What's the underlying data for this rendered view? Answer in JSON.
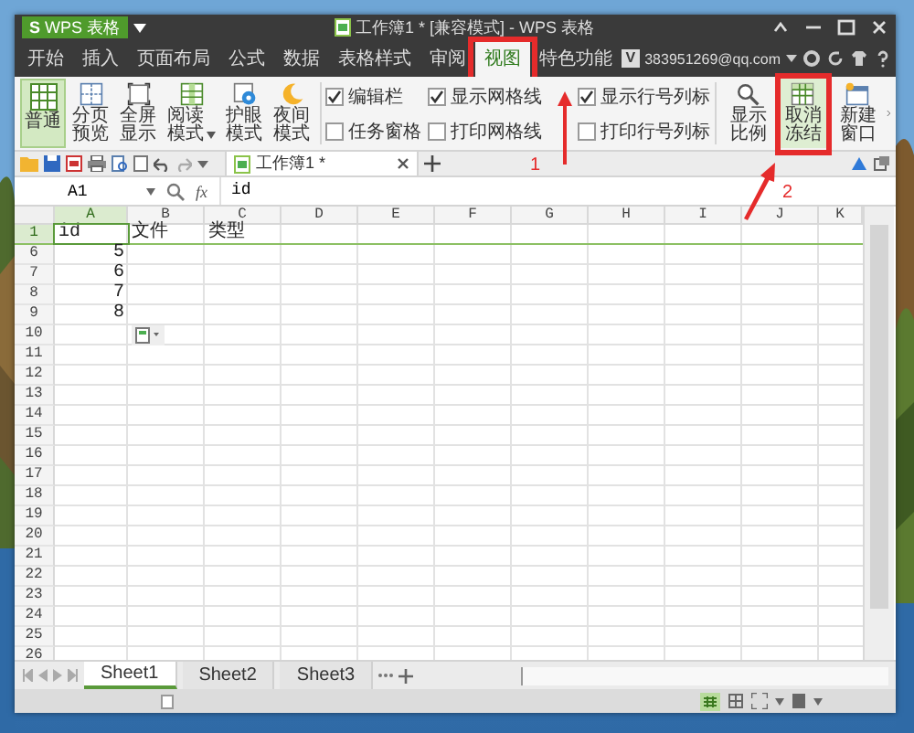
{
  "title_bar": {
    "logo": "S",
    "app_name": "WPS 表格",
    "title": "工作簿1 * [兼容模式] - WPS 表格"
  },
  "menu_tabs": [
    {
      "label": "开始",
      "selected": false,
      "highlighted": false
    },
    {
      "label": "插入",
      "selected": false,
      "highlighted": false
    },
    {
      "label": "页面布局",
      "selected": false,
      "highlighted": false
    },
    {
      "label": "公式",
      "selected": false,
      "highlighted": false
    },
    {
      "label": "数据",
      "selected": false,
      "highlighted": false
    },
    {
      "label": "表格样式",
      "selected": false,
      "highlighted": false
    },
    {
      "label": "审阅",
      "selected": false,
      "highlighted": false
    },
    {
      "label": "视图",
      "selected": true,
      "highlighted": true
    },
    {
      "label": "特色功能",
      "selected": false,
      "highlighted": false
    }
  ],
  "account": {
    "badge": "V",
    "email": "383951269@qq.com"
  },
  "ribbon": {
    "view_buttons": [
      {
        "label": "普通",
        "selected": true,
        "dropdown": false
      },
      {
        "label": "分页预览",
        "selected": false,
        "dropdown": false
      },
      {
        "label": "全屏显示",
        "selected": false,
        "dropdown": false
      },
      {
        "label": "阅读模式",
        "selected": false,
        "dropdown": true
      },
      {
        "label": "护眼模式",
        "selected": false,
        "dropdown": false
      },
      {
        "label": "夜间模式",
        "selected": false,
        "dropdown": false
      }
    ],
    "checkboxes": [
      {
        "label": "编辑栏",
        "checked": true
      },
      {
        "label": "任务窗格",
        "checked": false
      },
      {
        "label": "显示网格线",
        "checked": true
      },
      {
        "label": "打印网格线",
        "checked": false
      },
      {
        "label": "显示行号列标",
        "checked": true
      },
      {
        "label": "打印行号列标",
        "checked": false
      }
    ],
    "tools": [
      {
        "label": "显示比例",
        "hovered": false,
        "highlighted": false
      },
      {
        "label": "取消冻结",
        "hovered": true,
        "highlighted": true
      },
      {
        "label": "新建窗口",
        "hovered": false,
        "highlighted": false
      }
    ]
  },
  "document_tab": {
    "label": "工作簿1 *"
  },
  "formula_bar": {
    "cell_ref": "A1",
    "fx_label": "fx",
    "value": "id"
  },
  "sheet": {
    "columns": [
      {
        "label": "A",
        "selected": true
      },
      {
        "label": "B",
        "selected": false
      },
      {
        "label": "C",
        "selected": false
      },
      {
        "label": "D",
        "selected": false
      },
      {
        "label": "E",
        "selected": false
      },
      {
        "label": "F",
        "selected": false
      },
      {
        "label": "G",
        "selected": false
      },
      {
        "label": "H",
        "selected": false
      },
      {
        "label": "I",
        "selected": false
      },
      {
        "label": "J",
        "selected": false
      },
      {
        "label": "K",
        "selected": false
      }
    ],
    "rows": [
      {
        "number": "1",
        "selected": true,
        "cells": [
          {
            "text": "id",
            "kind": "text"
          },
          {
            "text": "文件",
            "kind": "text"
          },
          {
            "text": "类型",
            "kind": "text"
          }
        ]
      },
      {
        "number": "6",
        "selected": false,
        "cells": [
          {
            "text": "5",
            "kind": "number"
          }
        ]
      },
      {
        "number": "7",
        "selected": false,
        "cells": [
          {
            "text": "6",
            "kind": "number"
          }
        ]
      },
      {
        "number": "8",
        "selected": false,
        "cells": [
          {
            "text": "7",
            "kind": "number"
          }
        ]
      },
      {
        "number": "9",
        "selected": false,
        "cells": [
          {
            "text": "8",
            "kind": "number"
          }
        ]
      },
      {
        "number": "10",
        "selected": false
      },
      {
        "number": "11",
        "selected": false
      },
      {
        "number": "12",
        "selected": false
      },
      {
        "number": "13",
        "selected": false
      },
      {
        "number": "14",
        "selected": false
      },
      {
        "number": "15",
        "selected": false
      },
      {
        "number": "16",
        "selected": false
      },
      {
        "number": "17",
        "selected": false
      },
      {
        "number": "18",
        "selected": false
      },
      {
        "number": "19",
        "selected": false
      },
      {
        "number": "20",
        "selected": false
      },
      {
        "number": "21",
        "selected": false
      },
      {
        "number": "22",
        "selected": false
      },
      {
        "number": "23",
        "selected": false
      },
      {
        "number": "24",
        "selected": false
      },
      {
        "number": "25",
        "selected": false
      },
      {
        "number": "26",
        "selected": false
      }
    ]
  },
  "sheet_tabs": [
    {
      "label": "Sheet1",
      "selected": true
    },
    {
      "label": "Sheet2",
      "selected": false
    },
    {
      "label": "Sheet3",
      "selected": false
    }
  ],
  "annotations": [
    {
      "label": "1"
    },
    {
      "label": "2"
    }
  ]
}
